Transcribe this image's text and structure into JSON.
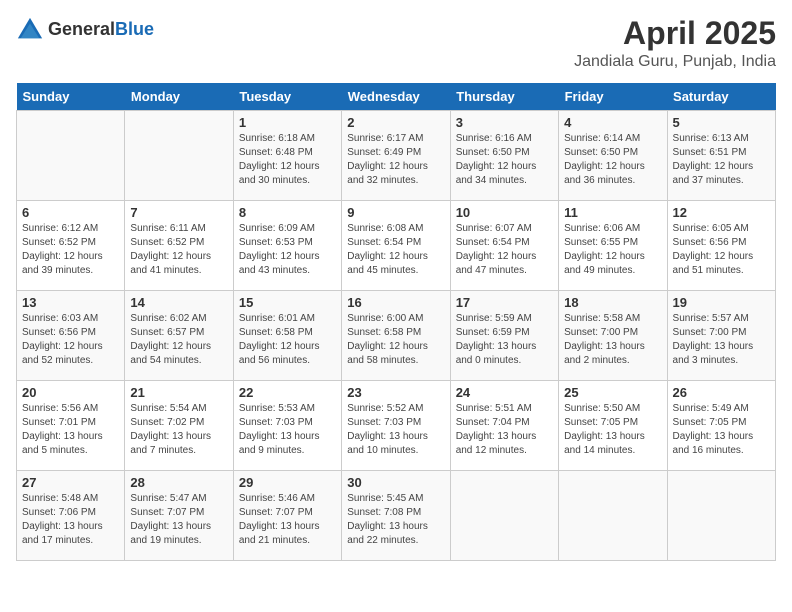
{
  "header": {
    "logo_general": "General",
    "logo_blue": "Blue",
    "title": "April 2025",
    "subtitle": "Jandiala Guru, Punjab, India"
  },
  "columns": [
    "Sunday",
    "Monday",
    "Tuesday",
    "Wednesday",
    "Thursday",
    "Friday",
    "Saturday"
  ],
  "weeks": [
    [
      {
        "day": "",
        "info": ""
      },
      {
        "day": "",
        "info": ""
      },
      {
        "day": "1",
        "info": "Sunrise: 6:18 AM\nSunset: 6:48 PM\nDaylight: 12 hours\nand 30 minutes."
      },
      {
        "day": "2",
        "info": "Sunrise: 6:17 AM\nSunset: 6:49 PM\nDaylight: 12 hours\nand 32 minutes."
      },
      {
        "day": "3",
        "info": "Sunrise: 6:16 AM\nSunset: 6:50 PM\nDaylight: 12 hours\nand 34 minutes."
      },
      {
        "day": "4",
        "info": "Sunrise: 6:14 AM\nSunset: 6:50 PM\nDaylight: 12 hours\nand 36 minutes."
      },
      {
        "day": "5",
        "info": "Sunrise: 6:13 AM\nSunset: 6:51 PM\nDaylight: 12 hours\nand 37 minutes."
      }
    ],
    [
      {
        "day": "6",
        "info": "Sunrise: 6:12 AM\nSunset: 6:52 PM\nDaylight: 12 hours\nand 39 minutes."
      },
      {
        "day": "7",
        "info": "Sunrise: 6:11 AM\nSunset: 6:52 PM\nDaylight: 12 hours\nand 41 minutes."
      },
      {
        "day": "8",
        "info": "Sunrise: 6:09 AM\nSunset: 6:53 PM\nDaylight: 12 hours\nand 43 minutes."
      },
      {
        "day": "9",
        "info": "Sunrise: 6:08 AM\nSunset: 6:54 PM\nDaylight: 12 hours\nand 45 minutes."
      },
      {
        "day": "10",
        "info": "Sunrise: 6:07 AM\nSunset: 6:54 PM\nDaylight: 12 hours\nand 47 minutes."
      },
      {
        "day": "11",
        "info": "Sunrise: 6:06 AM\nSunset: 6:55 PM\nDaylight: 12 hours\nand 49 minutes."
      },
      {
        "day": "12",
        "info": "Sunrise: 6:05 AM\nSunset: 6:56 PM\nDaylight: 12 hours\nand 51 minutes."
      }
    ],
    [
      {
        "day": "13",
        "info": "Sunrise: 6:03 AM\nSunset: 6:56 PM\nDaylight: 12 hours\nand 52 minutes."
      },
      {
        "day": "14",
        "info": "Sunrise: 6:02 AM\nSunset: 6:57 PM\nDaylight: 12 hours\nand 54 minutes."
      },
      {
        "day": "15",
        "info": "Sunrise: 6:01 AM\nSunset: 6:58 PM\nDaylight: 12 hours\nand 56 minutes."
      },
      {
        "day": "16",
        "info": "Sunrise: 6:00 AM\nSunset: 6:58 PM\nDaylight: 12 hours\nand 58 minutes."
      },
      {
        "day": "17",
        "info": "Sunrise: 5:59 AM\nSunset: 6:59 PM\nDaylight: 13 hours\nand 0 minutes."
      },
      {
        "day": "18",
        "info": "Sunrise: 5:58 AM\nSunset: 7:00 PM\nDaylight: 13 hours\nand 2 minutes."
      },
      {
        "day": "19",
        "info": "Sunrise: 5:57 AM\nSunset: 7:00 PM\nDaylight: 13 hours\nand 3 minutes."
      }
    ],
    [
      {
        "day": "20",
        "info": "Sunrise: 5:56 AM\nSunset: 7:01 PM\nDaylight: 13 hours\nand 5 minutes."
      },
      {
        "day": "21",
        "info": "Sunrise: 5:54 AM\nSunset: 7:02 PM\nDaylight: 13 hours\nand 7 minutes."
      },
      {
        "day": "22",
        "info": "Sunrise: 5:53 AM\nSunset: 7:03 PM\nDaylight: 13 hours\nand 9 minutes."
      },
      {
        "day": "23",
        "info": "Sunrise: 5:52 AM\nSunset: 7:03 PM\nDaylight: 13 hours\nand 10 minutes."
      },
      {
        "day": "24",
        "info": "Sunrise: 5:51 AM\nSunset: 7:04 PM\nDaylight: 13 hours\nand 12 minutes."
      },
      {
        "day": "25",
        "info": "Sunrise: 5:50 AM\nSunset: 7:05 PM\nDaylight: 13 hours\nand 14 minutes."
      },
      {
        "day": "26",
        "info": "Sunrise: 5:49 AM\nSunset: 7:05 PM\nDaylight: 13 hours\nand 16 minutes."
      }
    ],
    [
      {
        "day": "27",
        "info": "Sunrise: 5:48 AM\nSunset: 7:06 PM\nDaylight: 13 hours\nand 17 minutes."
      },
      {
        "day": "28",
        "info": "Sunrise: 5:47 AM\nSunset: 7:07 PM\nDaylight: 13 hours\nand 19 minutes."
      },
      {
        "day": "29",
        "info": "Sunrise: 5:46 AM\nSunset: 7:07 PM\nDaylight: 13 hours\nand 21 minutes."
      },
      {
        "day": "30",
        "info": "Sunrise: 5:45 AM\nSunset: 7:08 PM\nDaylight: 13 hours\nand 22 minutes."
      },
      {
        "day": "",
        "info": ""
      },
      {
        "day": "",
        "info": ""
      },
      {
        "day": "",
        "info": ""
      }
    ]
  ]
}
